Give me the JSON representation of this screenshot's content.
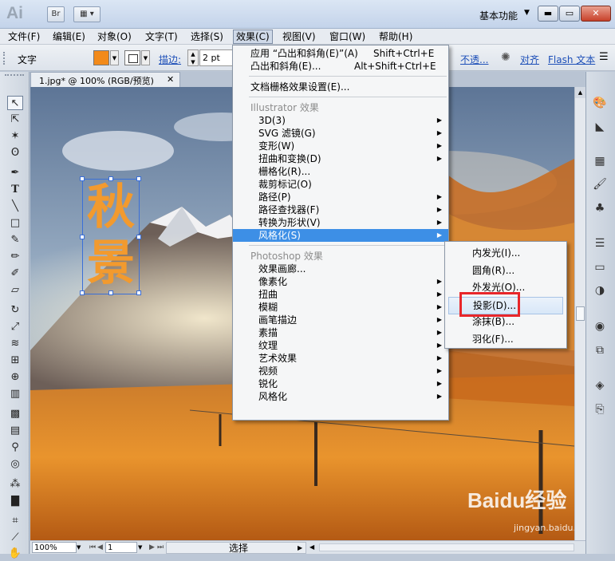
{
  "titlebar": {
    "app_logo": "Ai",
    "bridge_button": "Br",
    "workspace": "基本功能",
    "icons": [
      "arrange-documents-icon",
      "minimize-icon",
      "restore-icon",
      "close-icon"
    ]
  },
  "menubar": [
    "文件(F)",
    "编辑(E)",
    "对象(O)",
    "文字(T)",
    "选择(S)",
    "效果(C)",
    "视图(V)",
    "窗口(W)",
    "帮助(H)"
  ],
  "controlbar": {
    "tool_label": "文字",
    "fill_color": "#f28a1a",
    "stroke_label": "描边:",
    "stroke_weight": "2 pt",
    "opacity_label": "不透...",
    "align_label": "对齐",
    "flash_text_label": "Flash 文本"
  },
  "document": {
    "tab_title": "1.jpg* @ 100% (RGB/预览)",
    "artwork_text": [
      "秋",
      "景"
    ],
    "artwork_color": "#f29a2e"
  },
  "effect_menu": {
    "items": [
      {
        "type": "item",
        "label": "应用 “凸出和斜角(E)”(A)",
        "shortcut": "Shift+Ctrl+E"
      },
      {
        "type": "item",
        "label": "凸出和斜角(E)...",
        "shortcut": "Alt+Shift+Ctrl+E"
      },
      {
        "type": "sep"
      },
      {
        "type": "item",
        "label": "文档栅格效果设置(E)..."
      },
      {
        "type": "sep"
      },
      {
        "type": "header",
        "label": "Illustrator 效果"
      },
      {
        "type": "item",
        "label": "3D(3)",
        "submenu": true
      },
      {
        "type": "item",
        "label": "SVG 滤镜(G)",
        "submenu": true
      },
      {
        "type": "item",
        "label": "变形(W)",
        "submenu": true
      },
      {
        "type": "item",
        "label": "扭曲和变换(D)",
        "submenu": true
      },
      {
        "type": "item",
        "label": "栅格化(R)..."
      },
      {
        "type": "item",
        "label": "裁剪标记(O)"
      },
      {
        "type": "item",
        "label": "路径(P)",
        "submenu": true
      },
      {
        "type": "item",
        "label": "路径查找器(F)",
        "submenu": true
      },
      {
        "type": "item",
        "label": "转换为形状(V)",
        "submenu": true
      },
      {
        "type": "item",
        "label": "风格化(S)",
        "submenu": true,
        "highlighted": true
      },
      {
        "type": "sep"
      },
      {
        "type": "header",
        "label": "Photoshop 效果"
      },
      {
        "type": "item",
        "label": "效果画廊..."
      },
      {
        "type": "item",
        "label": "像素化",
        "submenu": true
      },
      {
        "type": "item",
        "label": "扭曲",
        "submenu": true
      },
      {
        "type": "item",
        "label": "模糊",
        "submenu": true
      },
      {
        "type": "item",
        "label": "画笔描边",
        "submenu": true
      },
      {
        "type": "item",
        "label": "素描",
        "submenu": true
      },
      {
        "type": "item",
        "label": "纹理",
        "submenu": true
      },
      {
        "type": "item",
        "label": "艺术效果",
        "submenu": true
      },
      {
        "type": "item",
        "label": "视频",
        "submenu": true
      },
      {
        "type": "item",
        "label": "锐化",
        "submenu": true
      },
      {
        "type": "item",
        "label": "风格化",
        "submenu": true
      }
    ]
  },
  "stylize_submenu": {
    "items": [
      "内发光(I)...",
      "圆角(R)...",
      "外发光(O)...",
      "投影(D)...",
      "涂抹(B)...",
      "羽化(F)..."
    ],
    "highlighted": "投影(D)..."
  },
  "statusbar": {
    "zoom": "100%",
    "page": "1",
    "tool_status": "选择"
  },
  "watermark": {
    "brand": "Baidu经验",
    "url": "jingyan.baidu.com"
  }
}
